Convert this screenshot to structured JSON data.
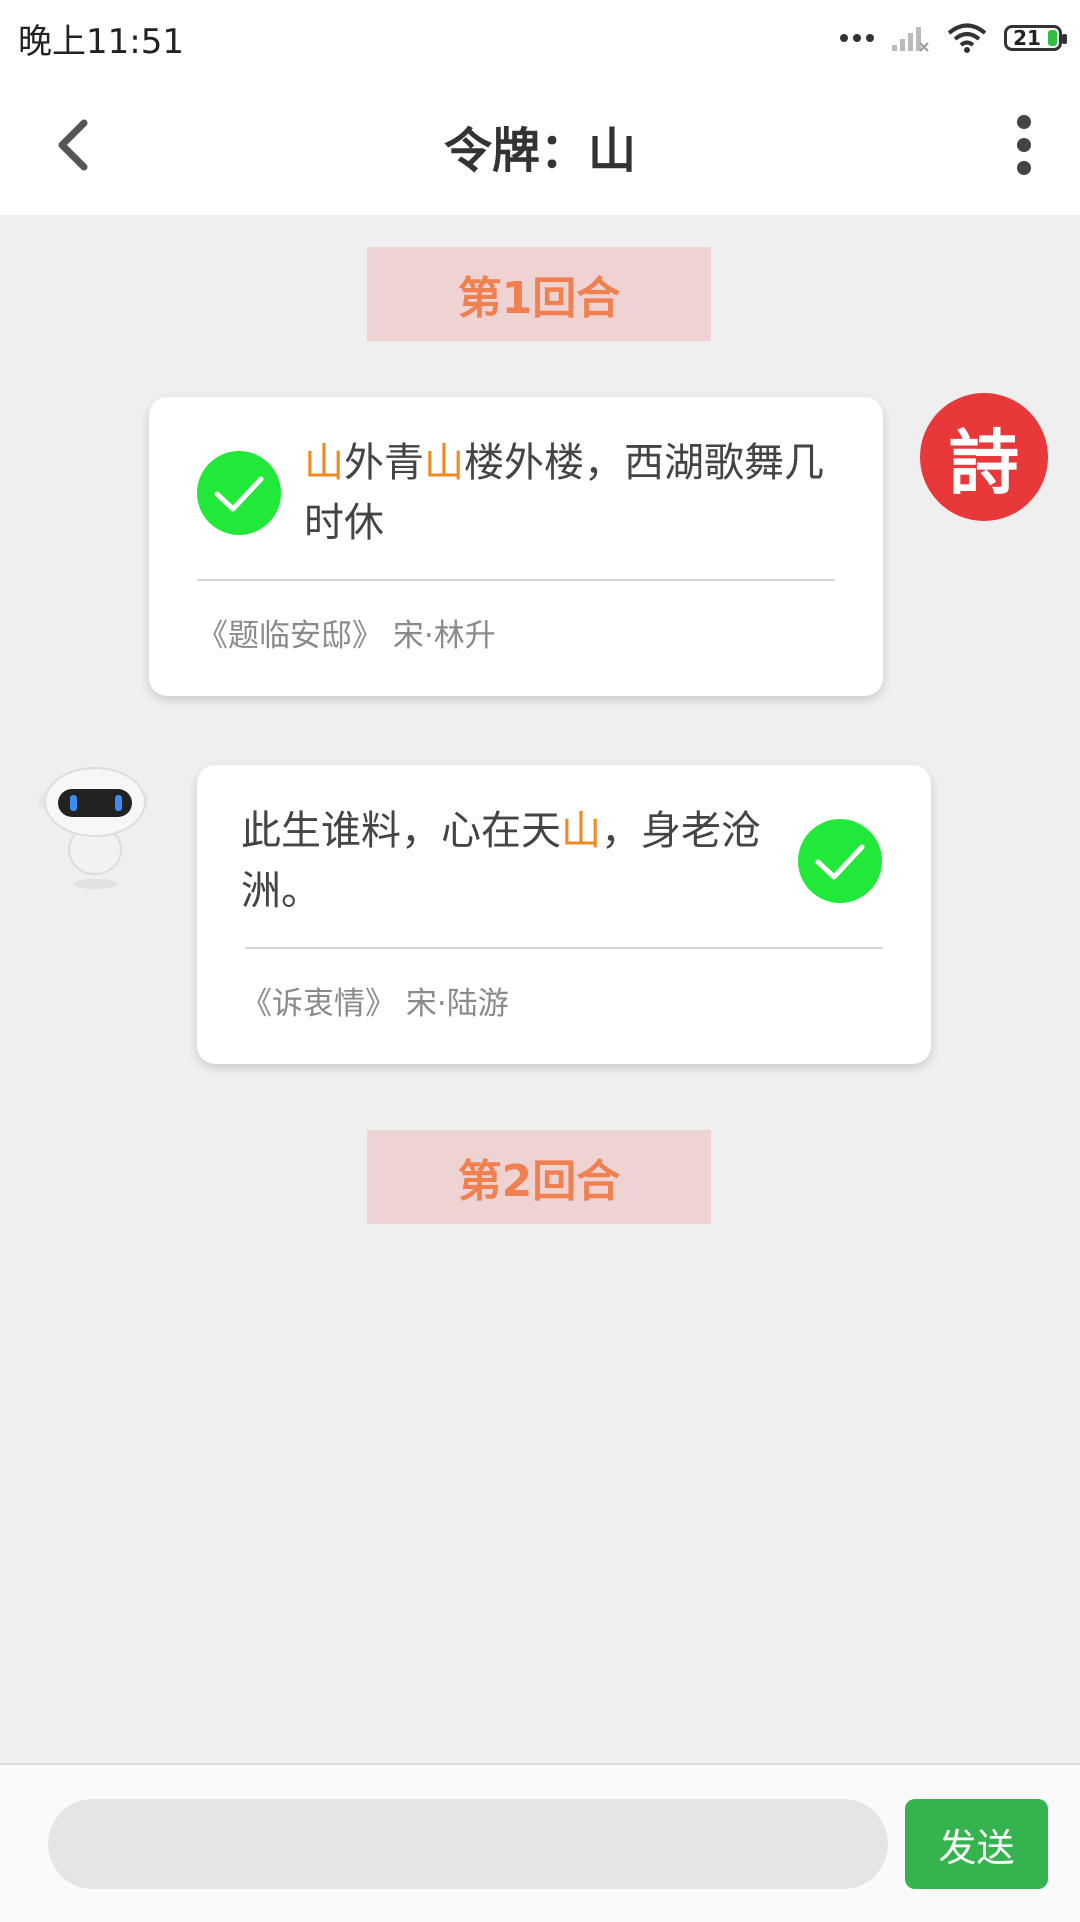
{
  "status_bar": {
    "time": "晚上11:51",
    "battery": "21"
  },
  "header": {
    "title": "令牌：山"
  },
  "rounds": [
    {
      "label": "第1回合"
    },
    {
      "label": "第2回合"
    }
  ],
  "messages": [
    {
      "sender": "poem-avatar",
      "avatar_text": "詩",
      "verse_parts": [
        "山",
        "外青",
        "山",
        "楼外楼，西湖歌舞几时休"
      ],
      "source": "《题临安邸》 宋·林升",
      "correct": true
    },
    {
      "sender": "robot",
      "verse_parts": [
        "此生谁料，心在天",
        "山",
        "，身老沧洲。"
      ],
      "source": "《诉衷情》 宋·陆游",
      "correct": true
    }
  ],
  "composer": {
    "placeholder": "",
    "send_label": "发送"
  },
  "colors": {
    "highlight": "#f08a1e",
    "check_green": "#22e83a",
    "send_green": "#34b34e",
    "round_bg": "#efd3d3",
    "round_text": "#f08050",
    "poem_avatar_bg": "#e8383a"
  }
}
